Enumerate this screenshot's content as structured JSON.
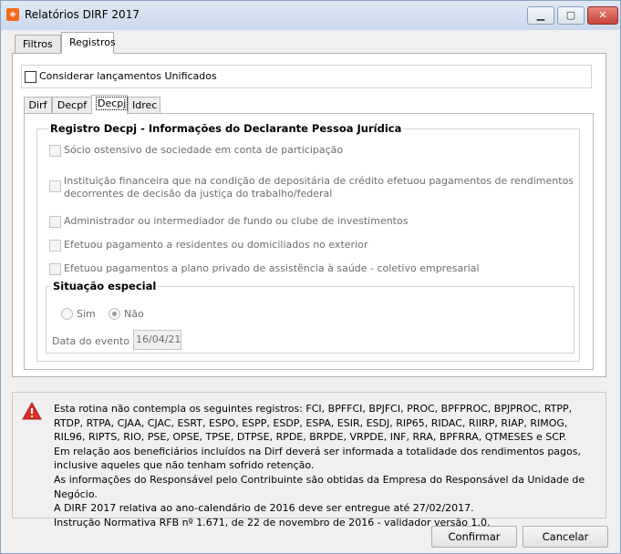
{
  "window": {
    "title": "Relatórios DIRF 2017"
  },
  "tabs": [
    {
      "label": "Filtros",
      "active": false
    },
    {
      "label": "Registros",
      "active": true
    }
  ],
  "unificados": {
    "label": "Considerar lançamentos Unificados",
    "checked": false
  },
  "subtabs": [
    {
      "label": "Dirf",
      "active": false
    },
    {
      "label": "Decpf",
      "active": false
    },
    {
      "label": "Decpj",
      "active": true
    },
    {
      "label": "Idrec",
      "active": false
    }
  ],
  "decpj": {
    "group_title": "Registro Decpj - Informações do Declarante Pessoa Jurídica",
    "options": [
      {
        "label": "Sócio ostensivo de sociedade em conta de participação",
        "checked": false,
        "enabled": false
      },
      {
        "label": "Instituição financeira que na condição de depositária de crédito efetuou pagamentos de rendimentos decorrentes de decisão da justiça do trabalho/federal",
        "checked": false,
        "enabled": false
      },
      {
        "label": "Administrador ou intermediador de fundo ou clube de investimentos",
        "checked": false,
        "enabled": false
      },
      {
        "label": "Efetuou pagamento a residentes ou domiciliados no exterior",
        "checked": false,
        "enabled": false
      },
      {
        "label": "Efetuou pagamentos a plano privado de assistência à saúde - coletivo empresarial",
        "checked": false,
        "enabled": false
      }
    ],
    "situacao": {
      "title": "Situação especial",
      "radio_sim": "Sim",
      "radio_nao": "Não",
      "selected": "Não",
      "date_label": "Data do evento",
      "date_value": "16/04/21"
    }
  },
  "info": {
    "icon": "warning-icon",
    "lines": [
      "Esta rotina não contempla os seguintes registros: FCI, BPFFCI, BPJFCI, PROC, BPFPROC, BPJPROC, RTPP, RTDP, RTPA, CJAA, CJAC, ESRT, ESPO, ESPP, ESDP, ESPA, ESIR, ESDJ, RIP65, RIDAC, RIIRP, RIAP, RIMOG, RIL96, RIPTS, RIO, PSE, OPSE, TPSE, DTPSE, RPDE, BRPDE, VRPDE, INF, RRA, BPFRRA, QTMESES e SCP.",
      "Em relação aos beneficiários incluídos na Dirf deverá ser informada a totalidade dos rendimentos pagos, inclusive aqueles que não tenham sofrido retenção.",
      "As informações do Responsável pelo Contribuinte são obtidas da Empresa do Responsável da Unidade de Negócio.",
      "A DIRF 2017 relativa ao ano-calendário de 2016 deve ser entregue até 27/02/2017.",
      "Instrução Normativa RFB nº 1.671, de 22 de novembro de 2016 - validador versão 1.0."
    ]
  },
  "buttons": {
    "confirm": "Confirmar",
    "cancel": "Cancelar"
  },
  "colors": {
    "warning": "#d9302c",
    "disabled_text": "#6d6d6d"
  }
}
